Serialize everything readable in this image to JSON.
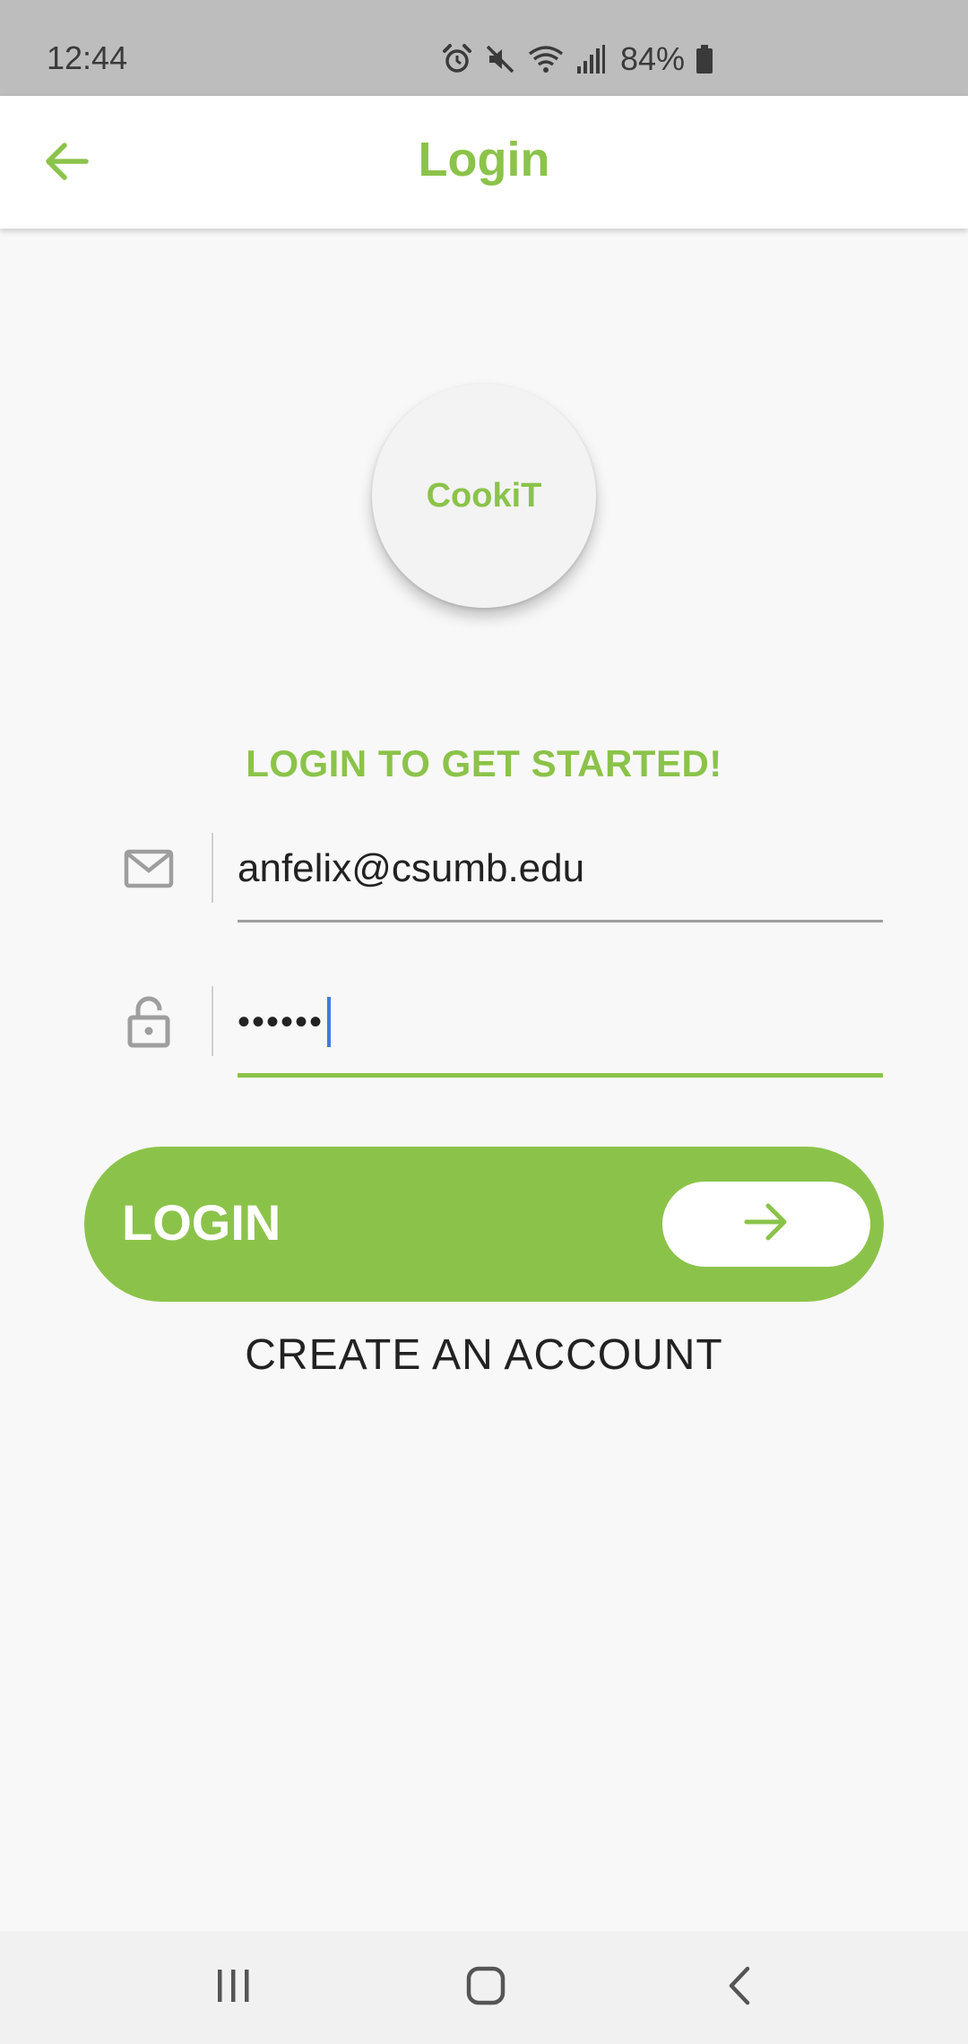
{
  "status_bar": {
    "time": "12:44",
    "battery": "84%",
    "icons": [
      "alarm-icon",
      "mute-icon",
      "wifi-icon",
      "signal-icon",
      "battery-icon"
    ]
  },
  "app_bar": {
    "title": "Login",
    "back_icon": "arrow-left-icon"
  },
  "logo": {
    "text": "CookiT"
  },
  "headline": "LOGIN TO GET STARTED!",
  "email_field": {
    "icon": "mail-icon",
    "value": "anfelix@csumb.edu"
  },
  "password_field": {
    "icon": "lock-icon",
    "value": "••••••"
  },
  "login_button": {
    "label": "LOGIN",
    "icon": "arrow-right-icon"
  },
  "create_account": "CREATE AN ACCOUNT",
  "nav_bar": {
    "items": [
      "recents-icon",
      "home-icon",
      "back-icon"
    ]
  },
  "colors": {
    "accent": "#8bc34a",
    "status_bar": "#bdbdbd",
    "background": "#f8f8f8",
    "caret": "#3b7de0"
  }
}
